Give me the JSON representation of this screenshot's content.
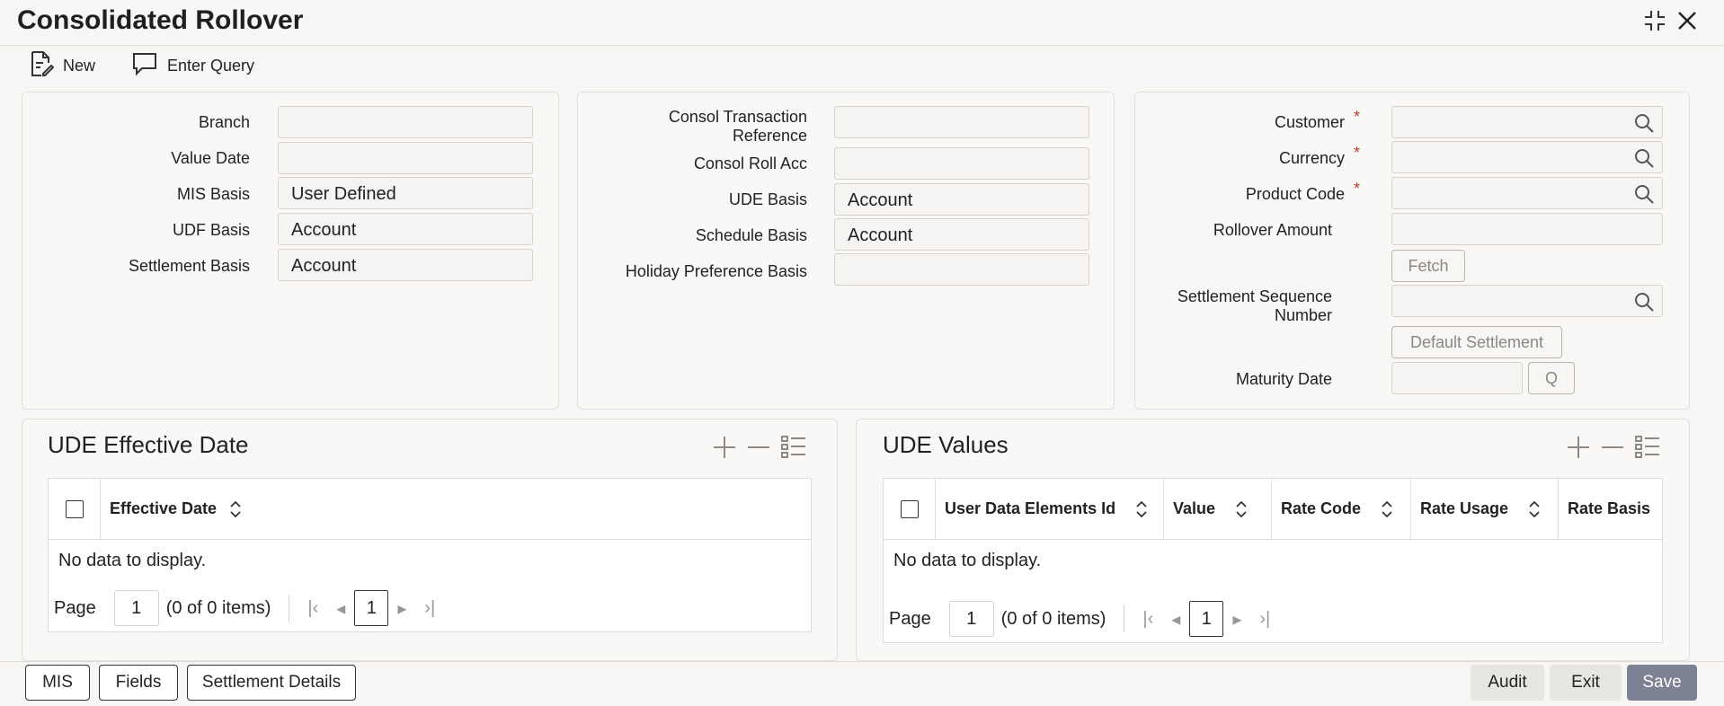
{
  "window": {
    "title": "Consolidated Rollover",
    "icons": {
      "minimize": "collapse-icon",
      "close": "close-icon"
    }
  },
  "toolbar": {
    "new_label": "New",
    "enter_query_label": "Enter Query"
  },
  "panel_left": {
    "branch_label": "Branch",
    "branch_value": "",
    "value_date_label": "Value Date",
    "value_date_value": "",
    "mis_basis_label": "MIS Basis",
    "mis_basis_value": "User Defined",
    "udf_basis_label": "UDF Basis",
    "udf_basis_value": "Account",
    "settlement_basis_label": "Settlement Basis",
    "settlement_basis_value": "Account"
  },
  "panel_middle": {
    "consol_txn_ref_label_1": "Consol Transaction",
    "consol_txn_ref_label_2": "Reference",
    "consol_txn_ref_value": "",
    "consol_roll_acc_label": "Consol Roll Acc",
    "consol_roll_acc_value": "",
    "ude_basis_label": "UDE Basis",
    "ude_basis_value": "Account",
    "schedule_basis_label": "Schedule Basis",
    "schedule_basis_value": "Account",
    "holiday_pref_label": "Holiday Preference Basis",
    "holiday_pref_value": ""
  },
  "panel_right": {
    "customer_label": "Customer",
    "currency_label": "Currency",
    "product_code_label": "Product Code",
    "required_mark": "*",
    "rollover_amount_label": "Rollover Amount",
    "fetch_label": "Fetch",
    "settlement_seq_label_1": "Settlement Sequence",
    "settlement_seq_label_2": "Number",
    "default_settlement_label": "Default Settlement",
    "maturity_date_label": "Maturity Date",
    "maturity_q_label": "Q"
  },
  "ude_effective_date": {
    "title": "UDE Effective Date",
    "columns": [
      "Effective Date"
    ],
    "empty_text": "No data to display.",
    "page_label": "Page",
    "page_input": "1",
    "items_text": "(0 of 0 items)",
    "current_page": "1"
  },
  "ude_values": {
    "title": "UDE Values",
    "columns": [
      "User Data Elements Id",
      "Value",
      "Rate Code",
      "Rate Usage",
      "Rate Basis"
    ],
    "empty_text": "No data to display.",
    "page_label": "Page",
    "page_input": "1",
    "items_text": "(0 of 0 items)",
    "current_page": "1"
  },
  "footer": {
    "mis_label": "MIS",
    "fields_label": "Fields",
    "settlement_details_label": "Settlement Details",
    "audit_label": "Audit",
    "exit_label": "Exit",
    "save_label": "Save"
  },
  "colors": {
    "save_bg": "#7c8193",
    "required": "#c0392b",
    "background": "#f7f6f4"
  }
}
